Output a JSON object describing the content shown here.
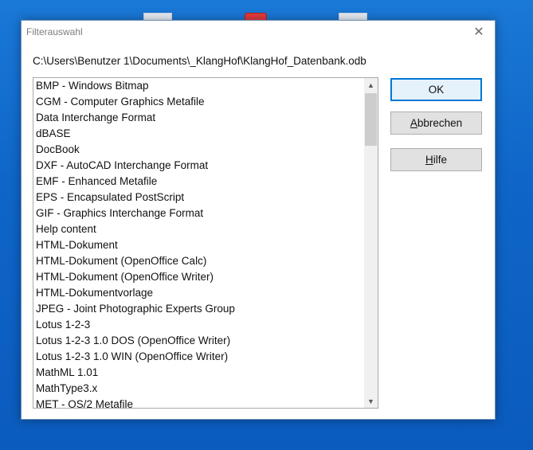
{
  "dialog": {
    "title": "Filterauswahl",
    "path": "C:\\Users\\Benutzer 1\\Documents\\_KlangHof\\KlangHof_Datenbank.odb",
    "items": [
      "BMP - Windows Bitmap",
      "CGM - Computer Graphics Metafile",
      "Data Interchange Format",
      "dBASE",
      "DocBook",
      "DXF - AutoCAD Interchange Format",
      "EMF - Enhanced Metafile",
      "EPS - Encapsulated PostScript",
      "GIF - Graphics Interchange Format",
      "Help content",
      "HTML-Dokument",
      "HTML-Dokument (OpenOffice Calc)",
      "HTML-Dokument (OpenOffice Writer)",
      "HTML-Dokumentvorlage",
      "JPEG - Joint Photographic Experts Group",
      "Lotus 1-2-3",
      "Lotus 1-2-3 1.0 DOS (OpenOffice Writer)",
      "Lotus 1-2-3 1.0 WIN (OpenOffice Writer)",
      "MathML 1.01",
      "MathType3.x",
      "MET - OS/2 Metafile"
    ],
    "buttons": {
      "ok": "OK",
      "cancel_mnemonic": "A",
      "cancel_rest": "bbrechen",
      "help_mnemonic": "H",
      "help_rest": "ilfe"
    }
  },
  "colors": {
    "accent": "#0078d7",
    "desktop": "#0f66c8"
  },
  "icons": {
    "close": "close-icon",
    "scroll_up": "chevron-up-icon",
    "scroll_down": "chevron-down-icon"
  }
}
